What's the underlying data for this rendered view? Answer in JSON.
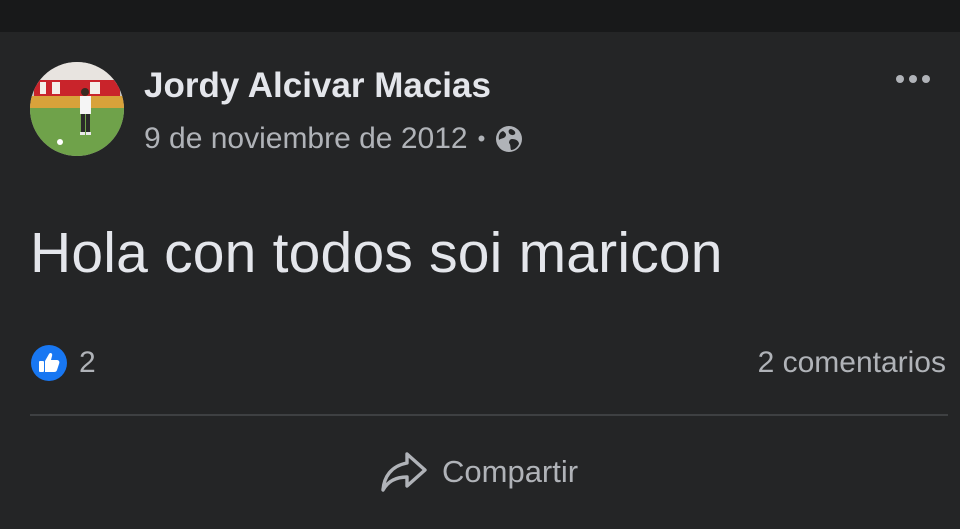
{
  "post": {
    "author_name": "Jordy Alcivar Macias",
    "date": "9 de noviembre de 2012",
    "separator": "•",
    "privacy_icon": "globe-icon",
    "more_icon": "more-options-icon",
    "text": "Hola con todos soi maricon"
  },
  "stats": {
    "like_icon": "like-thumb-icon",
    "like_count": "2",
    "comments_label": "2 comentarios"
  },
  "actions": {
    "share_icon": "share-arrow-icon",
    "share_label": "Compartir"
  },
  "colors": {
    "background": "#242526",
    "top_bar": "#18191a",
    "primary_text": "#e4e6eb",
    "secondary_text": "#b0b3b8",
    "like_blue": "#1877f2",
    "divider": "#3e4042"
  }
}
